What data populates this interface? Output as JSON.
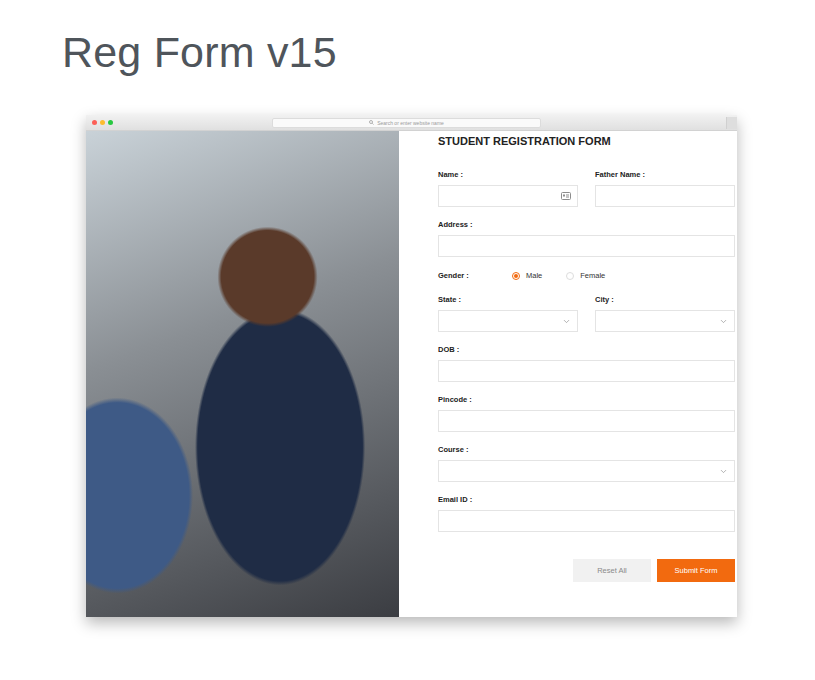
{
  "page": {
    "title": "Reg Form v15"
  },
  "browser": {
    "address_placeholder": "Search or enter website name"
  },
  "form": {
    "heading": "STUDENT REGISTRATION FORM",
    "rows": [
      [
        {
          "label": "Name :",
          "kind": "text",
          "value": "",
          "autofill": true
        },
        {
          "label": "Father Name :",
          "kind": "text",
          "value": "",
          "autofill": false
        }
      ],
      [
        {
          "label": "Address :",
          "kind": "text",
          "value": "",
          "autofill": false
        }
      ],
      [
        {
          "label": "Gender :",
          "kind": "radio",
          "options": [
            {
              "label": "Male",
              "selected": true
            },
            {
              "label": "Female",
              "selected": false
            }
          ]
        }
      ],
      [
        {
          "label": "State :",
          "kind": "select",
          "value": ""
        },
        {
          "label": "City :",
          "kind": "select",
          "value": ""
        }
      ],
      [
        {
          "label": "DOB :",
          "kind": "text",
          "value": "",
          "autofill": false
        }
      ],
      [
        {
          "label": "Pincode :",
          "kind": "text",
          "value": "",
          "autofill": false
        }
      ],
      [
        {
          "label": "Course :",
          "kind": "select",
          "value": ""
        }
      ],
      [
        {
          "label": "Email ID :",
          "kind": "text",
          "value": "",
          "autofill": false
        }
      ]
    ],
    "buttons": [
      {
        "label": "Reset All",
        "kind": "secondary"
      },
      {
        "label": "Submit Form",
        "kind": "primary"
      }
    ]
  }
}
